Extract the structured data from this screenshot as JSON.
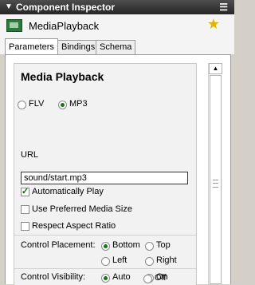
{
  "window": {
    "title": "Component Inspector",
    "collapse_glyph": "▼",
    "menu_glyph": "☰"
  },
  "component": {
    "name": "MediaPlayback",
    "icon": "media-component-icon",
    "pin_icon": "star-icon"
  },
  "tabs": [
    {
      "label": "Parameters",
      "active": true
    },
    {
      "label": "Bindings",
      "active": false
    },
    {
      "label": "Schema",
      "active": false
    }
  ],
  "params": {
    "section_title": "Media Playback",
    "format": {
      "options": [
        "FLV",
        "MP3"
      ],
      "selected": "MP3"
    },
    "url_label": "URL",
    "url_value": "sound/start.mp3",
    "checkboxes": [
      {
        "label": "Automatically Play",
        "checked": true
      },
      {
        "label": "Use Preferred Media Size",
        "checked": false
      },
      {
        "label": "Respect Aspect Ratio",
        "checked": false
      }
    ],
    "control_placement": {
      "label": "Control Placement:",
      "options": [
        "Bottom",
        "Top",
        "Left",
        "Right"
      ],
      "selected": "Bottom"
    },
    "control_visibility": {
      "label": "Control Visibility:",
      "options": [
        "Auto",
        "On",
        "Off"
      ],
      "selected": "Auto"
    }
  }
}
